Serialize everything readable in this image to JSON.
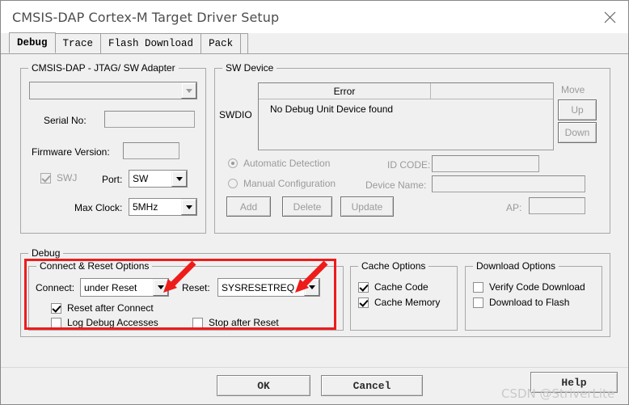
{
  "window": {
    "title": "CMSIS-DAP Cortex-M Target Driver Setup",
    "close_icon": "close-icon"
  },
  "tabs": [
    {
      "label": "Debug",
      "active": true
    },
    {
      "label": "Trace",
      "active": false
    },
    {
      "label": "Flash Download",
      "active": false
    },
    {
      "label": "Pack",
      "active": false
    }
  ],
  "adapter": {
    "legend": "CMSIS-DAP - JTAG/ SW Adapter",
    "device_combo_value": "",
    "serial_no_label": "Serial No:",
    "serial_no_value": "",
    "firmware_version_label": "Firmware Version:",
    "firmware_version_value": "",
    "swj_label": "SWJ",
    "swj_checked": true,
    "port_label": "Port:",
    "port_value": "SW",
    "max_clock_label": "Max Clock:",
    "max_clock_value": "5MHz"
  },
  "sw_device": {
    "legend": "SW Device",
    "swdio_label": "SWDIO",
    "columns": [
      "Error",
      ""
    ],
    "rows": [
      [
        "No Debug Unit Device found",
        ""
      ]
    ],
    "move_label": "Move",
    "up_label": "Up",
    "down_label": "Down",
    "automatic_detection_label": "Automatic Detection",
    "automatic_detection_selected": true,
    "manual_configuration_label": "Manual Configuration",
    "manual_configuration_selected": false,
    "id_code_label": "ID CODE:",
    "id_code_value": "",
    "device_name_label": "Device Name:",
    "device_name_value": "",
    "ap_label": "AP:",
    "ap_value": "",
    "add_label": "Add",
    "delete_label": "Delete",
    "update_label": "Update"
  },
  "debug": {
    "legend": "Debug",
    "connect_reset": {
      "legend": "Connect & Reset Options",
      "connect_label": "Connect:",
      "connect_value": "under Reset",
      "reset_label": "Reset:",
      "reset_value": "SYSRESETREQ",
      "reset_after_connect_label": "Reset after Connect",
      "reset_after_connect_checked": true,
      "log_debug_accesses_label": "Log Debug Accesses",
      "log_debug_accesses_checked": false,
      "stop_after_reset_label": "Stop after Reset",
      "stop_after_reset_checked": false
    },
    "cache": {
      "legend": "Cache Options",
      "cache_code_label": "Cache Code",
      "cache_code_checked": true,
      "cache_memory_label": "Cache Memory",
      "cache_memory_checked": true
    },
    "download": {
      "legend": "Download Options",
      "verify_code_download_label": "Verify Code Download",
      "verify_code_download_checked": false,
      "download_to_flash_label": "Download to Flash",
      "download_to_flash_checked": false
    }
  },
  "footer": {
    "ok_label": "OK",
    "cancel_label": "Cancel",
    "help_label": "Help"
  },
  "watermark": {
    "text": "CSDN @StriverLite"
  },
  "colors": {
    "annotation_red": "#ee1b1b",
    "dialog_bg": "#f0f0f0",
    "title_text": "#4d4d4d"
  }
}
